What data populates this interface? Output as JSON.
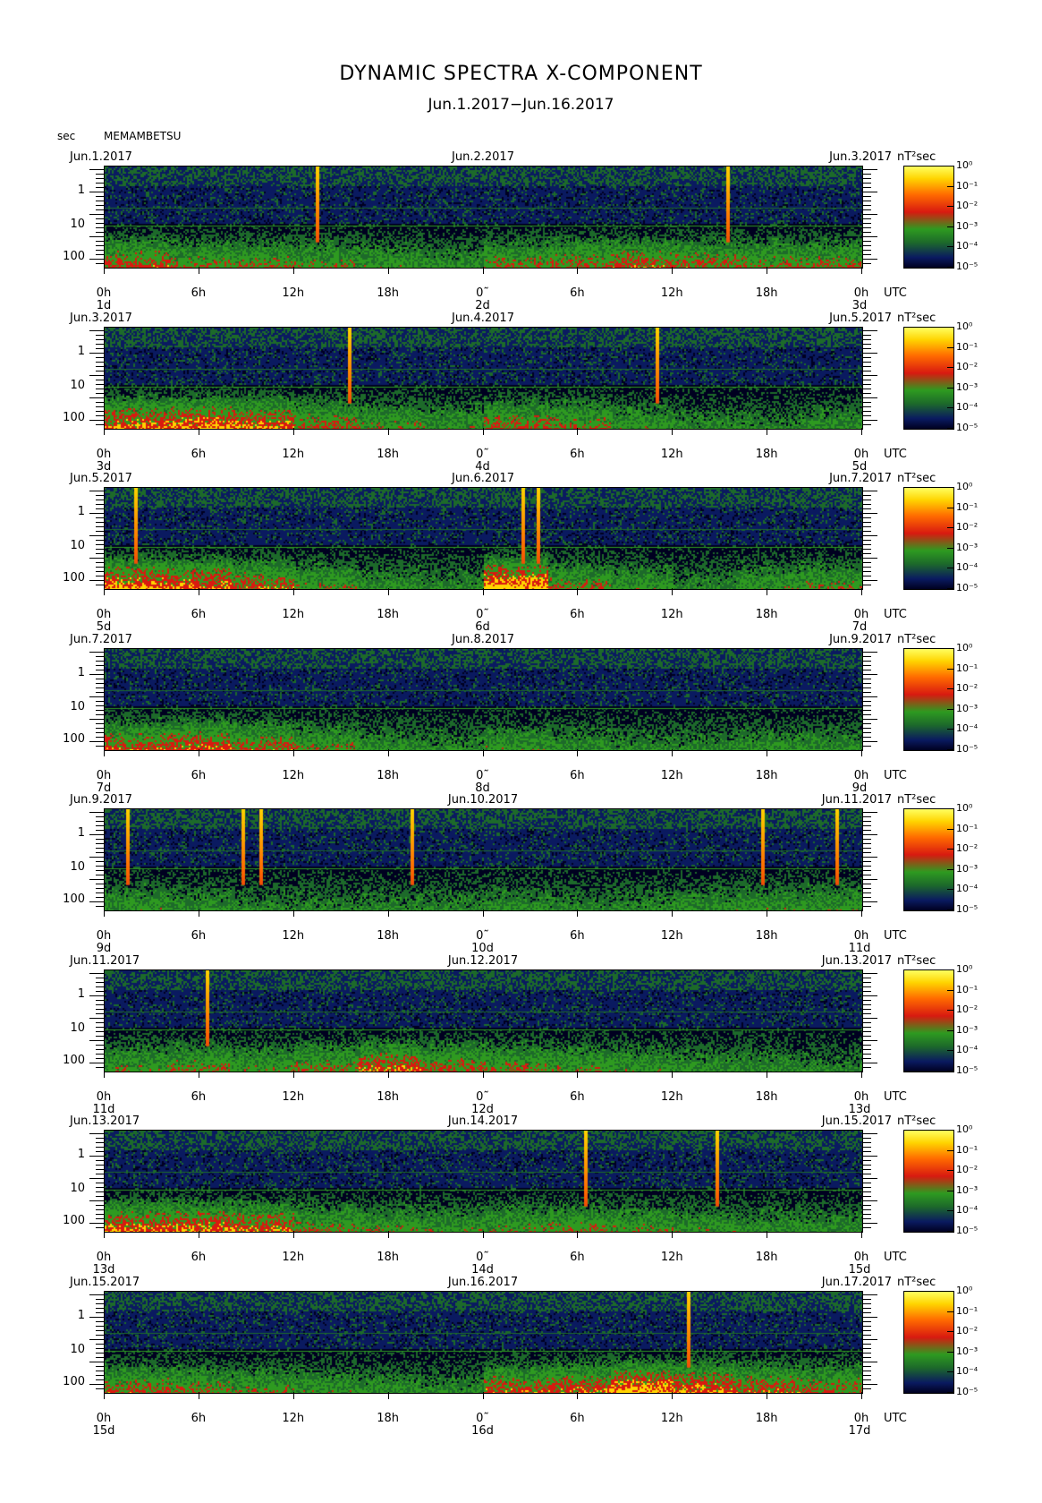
{
  "title": "DYNAMIC SPECTRA X-COMPONENT",
  "subtitle": "Jun.1.2017−Jun.16.2017",
  "axis_unit_label": "sec",
  "station": "MEMAMBETSU",
  "colorbar_unit": "nT²sec",
  "utc_label": "UTC",
  "colors": {
    "scale": [
      "#000020",
      "#0a1a60",
      "#1d6a2a",
      "#2e9a20",
      "#d81a10",
      "#ff6a00",
      "#ffd400",
      "#ffff60"
    ],
    "background": "#ffffff"
  },
  "chart_data": {
    "type": "heatmap",
    "description_axes": {
      "ylabel": "sec",
      "y_ticks": [
        "1",
        "10",
        "100"
      ],
      "y_scale": "log",
      "x_ticks": [
        "0h",
        "6h",
        "12h",
        "18h",
        "0h",
        "6h",
        "12h",
        "18h",
        "0h"
      ],
      "colorbar_ticks": [
        "10⁰",
        "10⁻¹",
        "10⁻²",
        "10⁻³",
        "10⁻⁴",
        "10⁻⁵"
      ],
      "colorbar_scale": "log"
    },
    "panels": [
      {
        "left_date": "Jun.1.2017",
        "mid_date": "Jun.2.2017",
        "right_date": "Jun.3.2017",
        "day_left": "1d",
        "day_mid": "2d",
        "day_right": "3d",
        "spikes_hours": [
          13.5,
          39.5
        ],
        "activity": [
          0.6,
          0.5,
          0.5,
          0.45,
          0.4,
          0.35,
          0.5,
          0.55,
          0.6,
          0.55,
          0.5,
          0.5
        ]
      },
      {
        "left_date": "Jun.3.2017",
        "mid_date": "Jun.4.2017",
        "right_date": "Jun.5.2017",
        "day_left": "3d",
        "day_mid": "4d",
        "day_right": "5d",
        "spikes_hours": [
          15.5,
          35.0
        ],
        "activity": [
          0.7,
          0.75,
          0.7,
          0.55,
          0.45,
          0.4,
          0.55,
          0.5,
          0.4,
          0.3,
          0.3,
          0.35
        ]
      },
      {
        "left_date": "Jun.5.2017",
        "mid_date": "Jun.6.2017",
        "right_date": "Jun.7.2017",
        "day_left": "5d",
        "day_mid": "6d",
        "day_right": "7d",
        "spikes_hours": [
          2.0,
          26.5,
          27.5
        ],
        "activity": [
          0.75,
          0.7,
          0.6,
          0.45,
          0.35,
          0.3,
          0.85,
          0.5,
          0.4,
          0.3,
          0.4,
          0.45
        ]
      },
      {
        "left_date": "Jun.7.2017",
        "mid_date": "Jun.8.2017",
        "right_date": "Jun.9.2017",
        "day_left": "7d",
        "day_mid": "8d",
        "day_right": "9d",
        "spikes_hours": [],
        "activity": [
          0.6,
          0.65,
          0.55,
          0.45,
          0.35,
          0.3,
          0.4,
          0.35,
          0.3,
          0.3,
          0.35,
          0.35
        ]
      },
      {
        "left_date": "Jun.9.2017",
        "mid_date": "Jun.10.2017",
        "right_date": "Jun.11.2017",
        "day_left": "9d",
        "day_mid": "10d",
        "day_right": "11d",
        "spikes_hours": [
          1.5,
          8.8,
          9.9,
          19.5,
          41.7,
          46.4
        ],
        "activity": [
          0.4,
          0.35,
          0.3,
          0.3,
          0.3,
          0.3,
          0.35,
          0.3,
          0.3,
          0.35,
          0.4,
          0.4
        ]
      },
      {
        "left_date": "Jun.11.2017",
        "mid_date": "Jun.12.2017",
        "right_date": "Jun.13.2017",
        "day_left": "11d",
        "day_mid": "12d",
        "day_right": "13d",
        "spikes_hours": [
          6.5
        ],
        "activity": [
          0.45,
          0.5,
          0.45,
          0.5,
          0.65,
          0.55,
          0.5,
          0.45,
          0.4,
          0.35,
          0.35,
          0.3
        ]
      },
      {
        "left_date": "Jun.13.2017",
        "mid_date": "Jun.14.2017",
        "right_date": "Jun.15.2017",
        "day_left": "13d",
        "day_mid": "14d",
        "day_right": "15d",
        "spikes_hours": [
          30.5,
          38.8
        ],
        "activity": [
          0.7,
          0.7,
          0.65,
          0.5,
          0.45,
          0.4,
          0.45,
          0.5,
          0.45,
          0.4,
          0.35,
          0.35
        ]
      },
      {
        "left_date": "Jun.15.2017",
        "mid_date": "Jun.16.2017",
        "right_date": "Jun.17.2017",
        "day_left": "15d",
        "day_mid": "16d",
        "day_right": "17d",
        "spikes_hours": [
          37.0
        ],
        "activity": [
          0.55,
          0.5,
          0.45,
          0.4,
          0.35,
          0.3,
          0.6,
          0.65,
          0.8,
          0.7,
          0.6,
          0.55
        ]
      }
    ]
  }
}
